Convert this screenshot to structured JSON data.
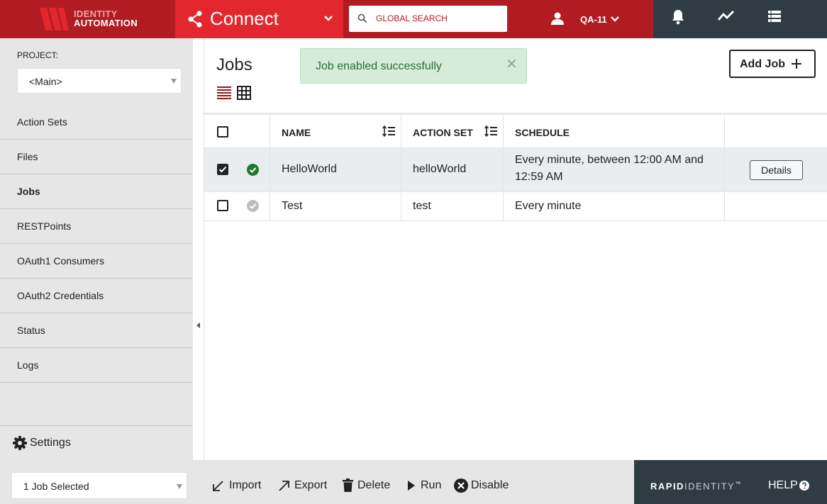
{
  "header": {
    "logo_line1": "IDENTITY",
    "logo_line2": "AUTOMATION",
    "app_title": "Connect",
    "search_placeholder": "GLOBAL SEARCH",
    "user_name": "QA-11",
    "icons": [
      "share-icon",
      "chevron-down-icon",
      "search-icon",
      "user-icon",
      "bell-icon",
      "activity-icon",
      "list-icon"
    ]
  },
  "sidebar": {
    "project_label": "PROJECT:",
    "project_value": "<Main>",
    "items": [
      {
        "label": "Action Sets",
        "active": false
      },
      {
        "label": "Files",
        "active": false
      },
      {
        "label": "Jobs",
        "active": true
      },
      {
        "label": "RESTPoints",
        "active": false
      },
      {
        "label": "OAuth1 Consumers",
        "active": false
      },
      {
        "label": "OAuth2 Credentials",
        "active": false
      },
      {
        "label": "Status",
        "active": false
      },
      {
        "label": "Logs",
        "active": false
      }
    ],
    "settings_label": "Settings"
  },
  "main": {
    "title": "Jobs",
    "toast_message": "Job enabled successfully",
    "add_button_label": "Add Job",
    "table": {
      "columns": [
        "NAME",
        "ACTION SET",
        "SCHEDULE"
      ],
      "rows": [
        {
          "selected": true,
          "enabled": true,
          "name": "HelloWorld",
          "action_set": "helloWorld",
          "schedule_line1": "Every minute, between 12:00 AM and",
          "schedule_line2": "12:59 AM",
          "action_label": "Details"
        },
        {
          "selected": false,
          "enabled": false,
          "name": "Test",
          "action_set": "test",
          "schedule_line1": "Every minute",
          "schedule_line2": "",
          "action_label": ""
        }
      ]
    }
  },
  "bottombar": {
    "selection_label": "1 Job Selected",
    "actions": {
      "import": "Import",
      "export": "Export",
      "delete": "Delete",
      "run": "Run",
      "disable": "Disable"
    },
    "brand_bold": "RAPID",
    "brand_light": "IDENTITY",
    "brand_tm": "™",
    "help_label": "HELP"
  },
  "colors": {
    "brand_red": "#e2282e",
    "dark_red": "#b01c22",
    "dark_slate": "#2f3c44",
    "success_green": "#1e7a2e"
  }
}
